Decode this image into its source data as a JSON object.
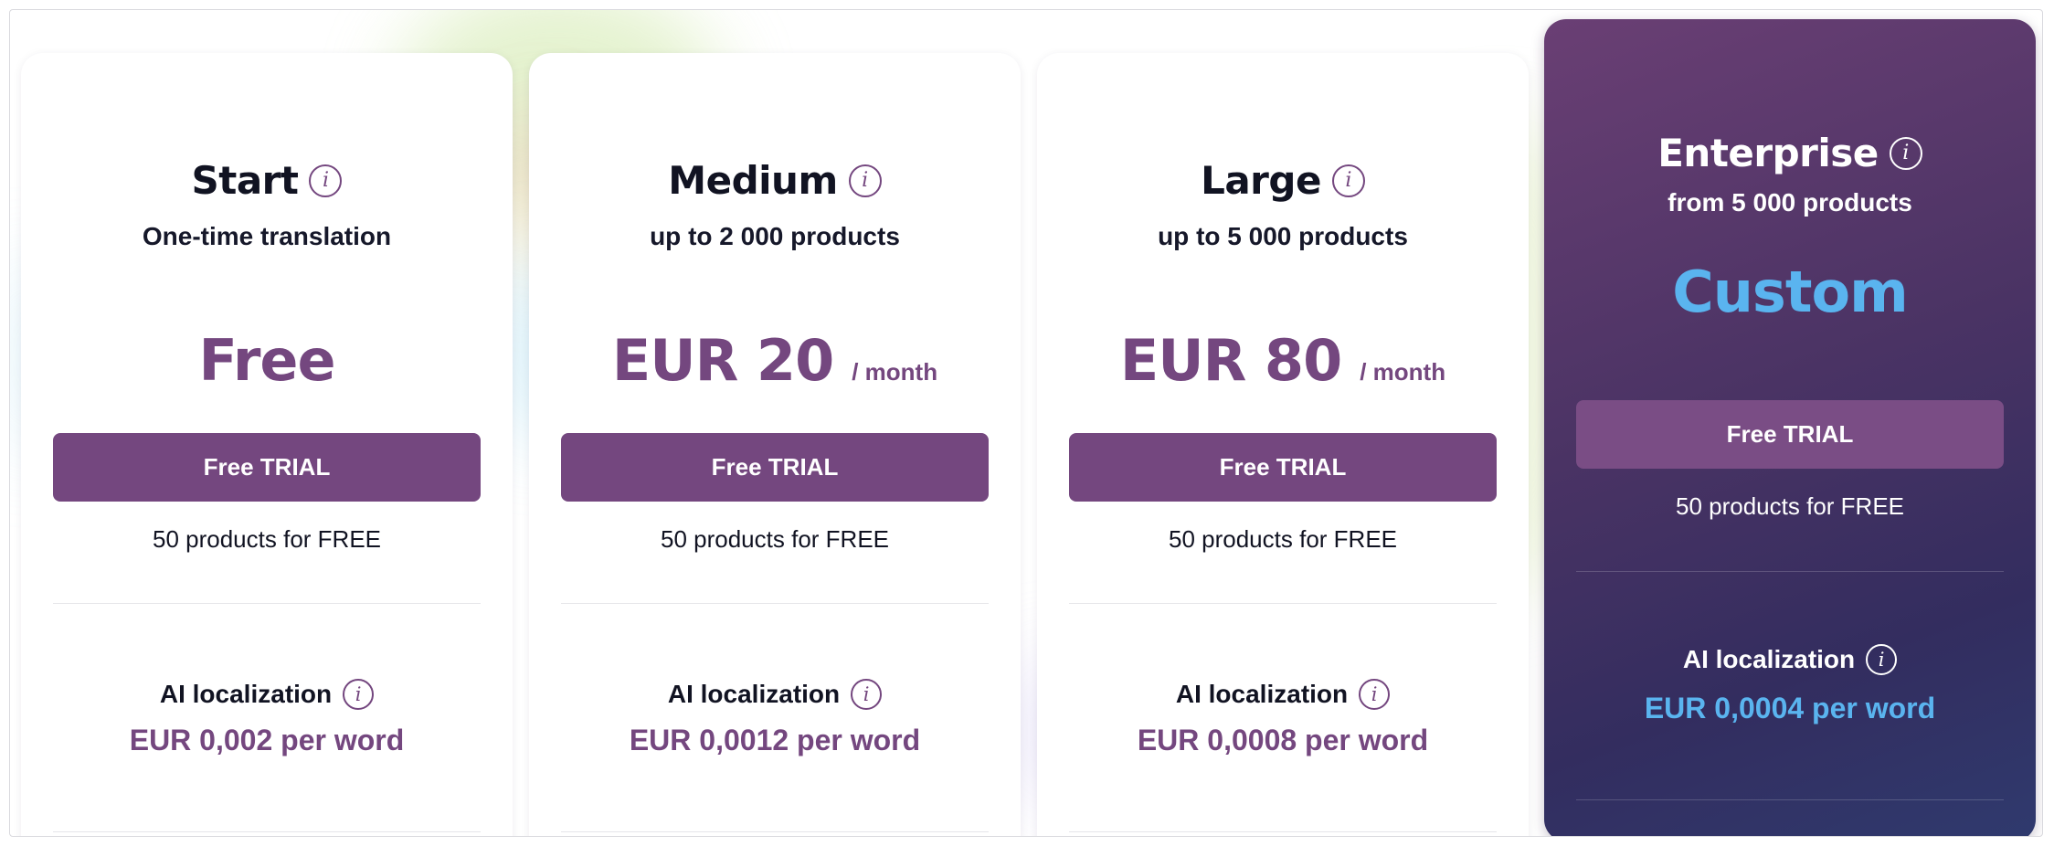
{
  "plans": [
    {
      "title": "Start",
      "subtitle": "One-time translation",
      "price": "Free",
      "price_unit": "",
      "cta_label": "Free TRIAL",
      "note": "50 products for FREE",
      "feature_label": "AI localization",
      "feature_price": "EUR 0,002 per word",
      "icon": "info-icon"
    },
    {
      "title": "Medium",
      "subtitle": "up to 2 000 products",
      "price": "EUR 20",
      "price_unit": "/ month",
      "cta_label": "Free TRIAL",
      "note": "50 products for FREE",
      "feature_label": "AI localization",
      "feature_price": "EUR 0,0012 per word",
      "icon": "info-icon"
    },
    {
      "title": "Large",
      "subtitle": "up to 5 000 products",
      "price": "EUR 80",
      "price_unit": "/ month",
      "cta_label": "Free TRIAL",
      "note": "50 products for FREE",
      "feature_label": "AI localization",
      "feature_price": "EUR 0,0008 per word",
      "icon": "info-icon"
    },
    {
      "title": "Enterprise",
      "subtitle": "from 5 000 products",
      "price": "Custom",
      "price_unit": "",
      "cta_label": "Free TRIAL",
      "note": "50 products for FREE",
      "feature_label": "AI localization",
      "feature_price": "EUR 0,0004 per word",
      "icon": "info-icon"
    }
  ],
  "colors": {
    "brand_purple": "#74477f",
    "enterprise_accent": "#5ab4ef",
    "enterprise_bg_top": "#6a3f74",
    "enterprise_bg_bottom": "#2f3a6e",
    "heading_text": "#111322"
  }
}
